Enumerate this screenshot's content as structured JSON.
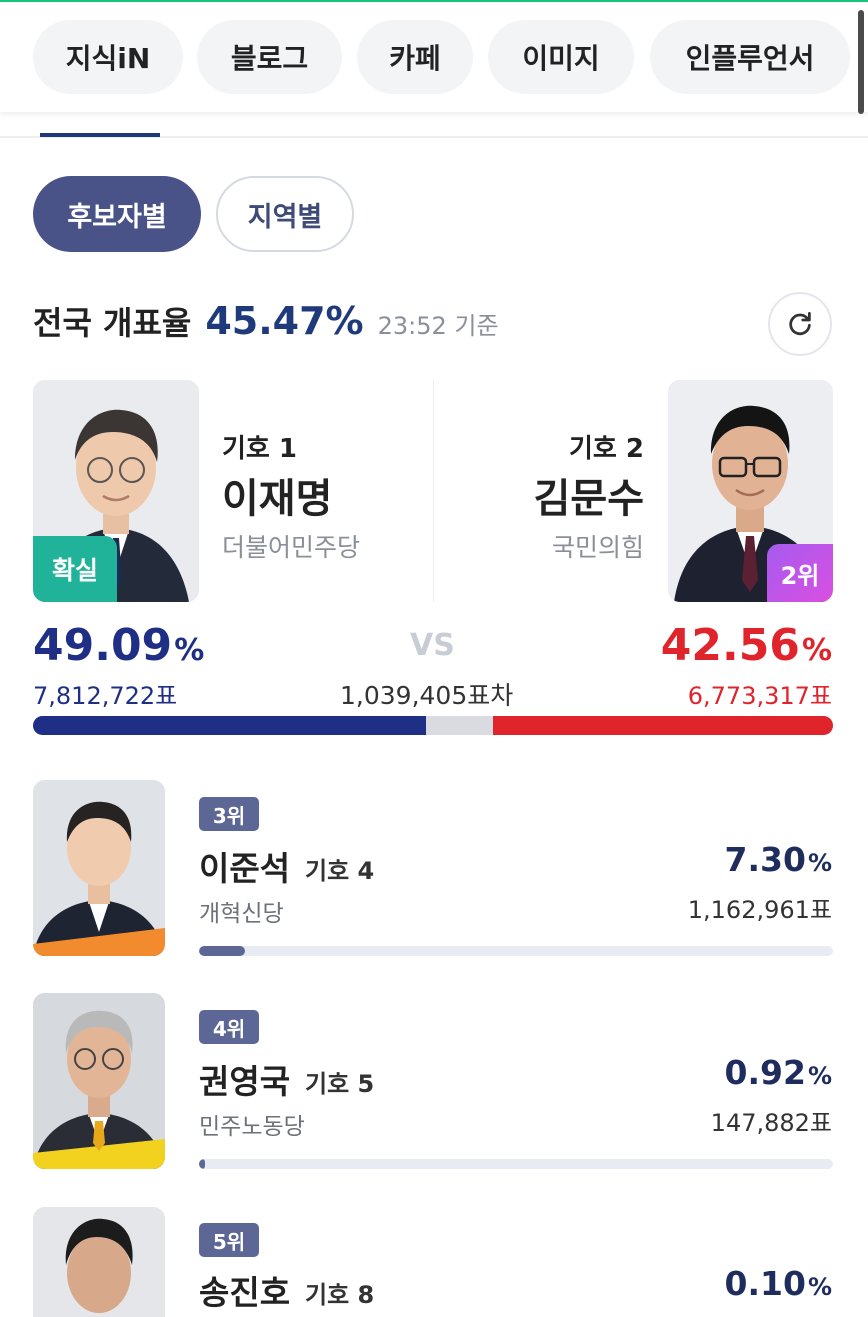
{
  "nav": {
    "chips": [
      "지식iN",
      "블로그",
      "카페",
      "이미지",
      "인플루언서"
    ]
  },
  "segment": {
    "by_candidate": "후보자별",
    "by_region": "지역별"
  },
  "summary": {
    "label": "전국 개표율",
    "rate": "45.47%",
    "time": "23:52 기준"
  },
  "main": {
    "left": {
      "number_label": "기호 1",
      "name": "이재명",
      "party": "더불어민주당",
      "badge": "확실",
      "percent": "49.09",
      "votes": "7,812,722표",
      "share": 0.4909
    },
    "right": {
      "number_label": "기호 2",
      "name": "김문수",
      "party": "국민의힘",
      "badge": "2위",
      "percent": "42.56",
      "votes": "6,773,317표",
      "share": 0.4256
    },
    "vs": "VS",
    "difference": "1,039,405표차",
    "percent_unit": "%"
  },
  "others": [
    {
      "rank": "3위",
      "name": "이준석",
      "number_label": "기호 4",
      "party": "개혁신당",
      "percent": "7.30",
      "votes": "1,162,961표",
      "share": 0.073
    },
    {
      "rank": "4위",
      "name": "권영국",
      "number_label": "기호 5",
      "party": "민주노동당",
      "percent": "0.92",
      "votes": "147,882표",
      "share": 0.0092
    },
    {
      "rank": "5위",
      "name": "송진호",
      "number_label": "기호 8",
      "party": "",
      "percent": "0.10",
      "votes": "",
      "share": 0.001
    }
  ],
  "colors": {
    "left_party": "#1e2f85",
    "right_party": "#e0242c",
    "confirm_badge": "#21b39a",
    "rank_badge": "#5d6795",
    "accent_text": "#1f3a7a"
  },
  "icons": {
    "refresh": "refresh-icon"
  }
}
